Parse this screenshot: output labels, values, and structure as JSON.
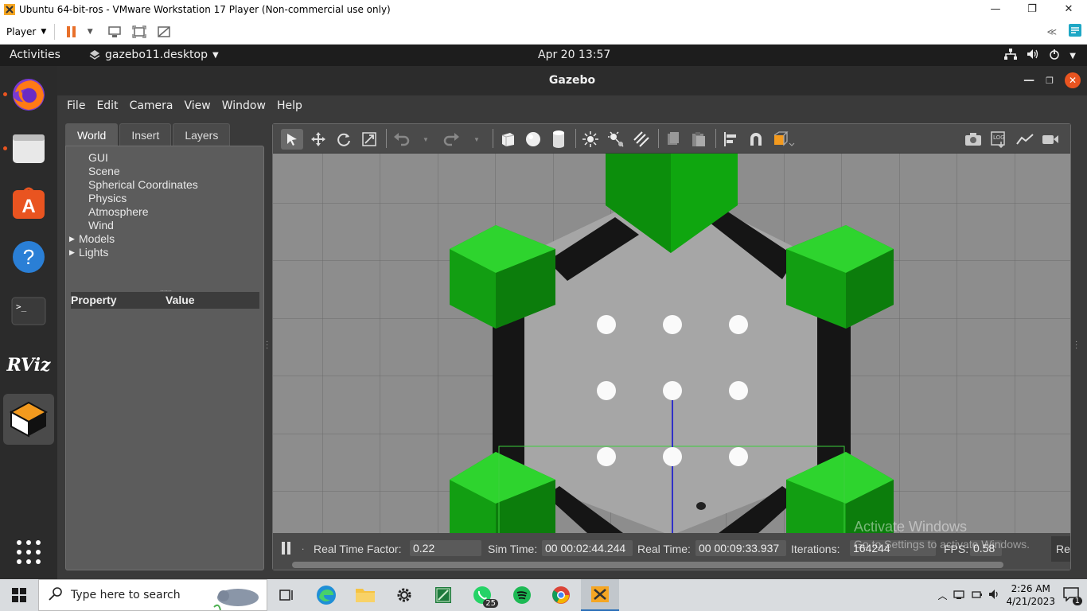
{
  "vmware": {
    "title": "Ubuntu 64-bit-ros - VMware Workstation 17 Player (Non-commercial use only)",
    "player_menu": "Player"
  },
  "ubuntu": {
    "activities": "Activities",
    "app_name": "gazebo11.desktop",
    "clock": "Apr 20  13:57",
    "dock_items": [
      "firefox-icon",
      "files-icon",
      "app-center-icon",
      "help-icon",
      "terminal-icon",
      "rviz-icon",
      "gazebo-icon",
      "show-apps-icon"
    ],
    "rviz_label": "RViz"
  },
  "gazebo": {
    "title": "Gazebo",
    "menu": [
      "File",
      "Edit",
      "Camera",
      "View",
      "Window",
      "Help"
    ],
    "tabs": [
      "World",
      "Insert",
      "Layers"
    ],
    "tree": [
      {
        "label": "GUI",
        "expandable": false
      },
      {
        "label": "Scene",
        "expandable": false
      },
      {
        "label": "Spherical Coordinates",
        "expandable": false
      },
      {
        "label": "Physics",
        "expandable": false
      },
      {
        "label": "Atmosphere",
        "expandable": false
      },
      {
        "label": "Wind",
        "expandable": false
      },
      {
        "label": "Models",
        "expandable": true
      },
      {
        "label": "Lights",
        "expandable": true
      }
    ],
    "property_header": {
      "property": "Property",
      "value": "Value"
    },
    "splitter": "......",
    "bottom": {
      "rtf_label": "Real Time Factor:",
      "rtf_value": "0.22",
      "sim_time_label": "Sim Time:",
      "sim_time_value": "00 00:02:44.244",
      "real_time_label": "Real Time:",
      "real_time_value": "00 00:09:33.937",
      "iterations_label": "Iterations:",
      "iterations_value": "164244",
      "fps_label": "FPS:",
      "fps_value": "0.58",
      "reset_label": "Re"
    },
    "watermark": "Activate Windows",
    "watermark2": "Go to Settings to activate Windows."
  },
  "taskbar": {
    "search_placeholder": "Type here to search",
    "whatsapp_badge": "25",
    "time": "2:26 AM",
    "date": "4/21/2023",
    "notification_count": "1"
  },
  "colors": {
    "green": "#17b817",
    "ubuntu_orange": "#e95420",
    "scene_bg": "#8c8c8c"
  }
}
